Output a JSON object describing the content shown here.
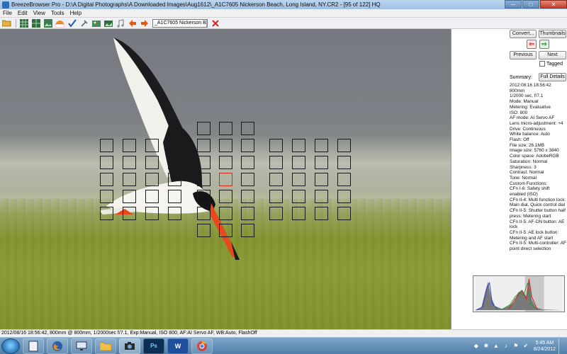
{
  "window": {
    "title": "BreezeBrowser Pro - D:\\A Digital Photographs\\A Downloaded Images\\Aug1612\\_A1C7605  Nickerson Beach, Long Island, NY.CR2 - [95 of 122] HQ",
    "minimize": "─",
    "maximize": "□",
    "close": "✕"
  },
  "menu": [
    "File",
    "Edit",
    "View",
    "Tools",
    "Help"
  ],
  "toolbar": {
    "file_select": "_A1C7605  Nickerson B",
    "icons": [
      "open-folder-icon",
      "grid-icon",
      "grid-large-icon",
      "image-icon",
      "raw-icon",
      "checkmark-icon",
      "tools-icon",
      "photo-icon",
      "photo-alt-icon",
      "music-icon",
      "arrow-left-icon",
      "arrow-right-icon",
      "delete-icon"
    ]
  },
  "side_panel": {
    "convert": "Convert...",
    "thumbnails": "Thumbnails",
    "previous": "Previous",
    "next": "Next",
    "tagged": "Tagged",
    "summary": "Summary:",
    "full_details": "Full Details",
    "metadata": [
      "2012:08:16 18:56:42",
      "800mm",
      "1/2000 sec, f/7.1",
      "Mode: Manual",
      "Metering: Evaluative",
      "ISO: 800",
      "AF mode: AI Servo AF",
      "Lens micro-adjustment: +4",
      "Drive: Continuous",
      "White balance: Auto",
      "Flash: Off",
      "File size: 26.1MB",
      "Image size: 5760 x 3840",
      "Color space: AdobeRGB",
      "Saturation: Normal",
      "Sharpness: 3",
      "Contrast: Normal",
      "Tone: Normal",
      "Custom Functions:",
      "CFn I-6: Safety shift enabled (ISO)",
      "CFn II-4: Multi function lock: Main dial, Quick control dial",
      "CFn II-5: Shutter button half press: Metering start",
      "CFn II-5: AF-ON button: AE lock",
      "CFn II-5: AE lock button: Metering and AF start",
      "CFn II-5: Multi-controller: AF point direct selection"
    ]
  },
  "status_bar": "2012/08/16 18:56:42, 800mm @ 800mm, 1/2000sec f/7.1, Exp:Manual, ISO 800, AF:AI Servo AF, WB:Auto, FlashOff",
  "taskbar": {
    "apps": [
      "file-manager-icon",
      "firefox-icon",
      "monitor-icon",
      "folder-icon",
      "camera-icon",
      "photoshop-icon",
      "word-icon",
      "chrome-icon"
    ],
    "photoshop_label": "Ps",
    "word_label": "W",
    "time": "5:45 AM",
    "date": "8/24/2012"
  },
  "colors": {
    "af_point": "#1b1b1b",
    "af_point_active": "#d42a1e"
  }
}
